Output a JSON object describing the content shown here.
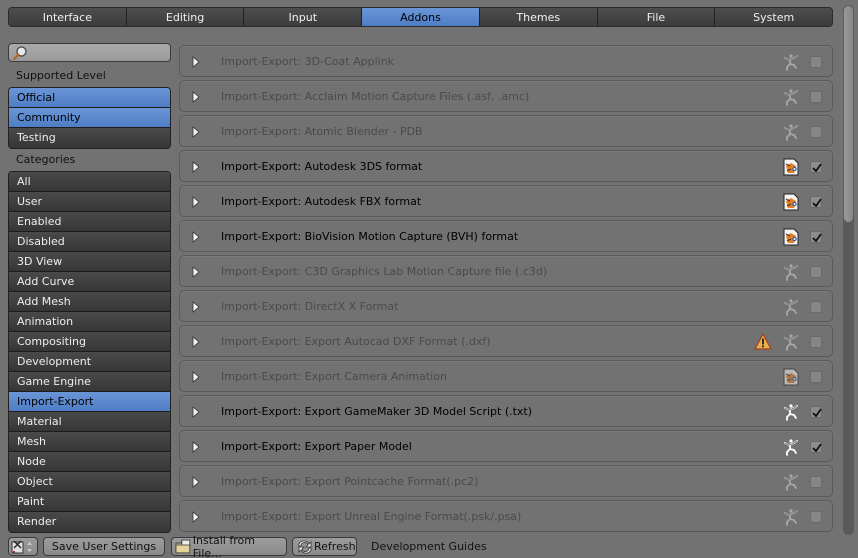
{
  "tabs": [
    {
      "label": "Interface",
      "active": false
    },
    {
      "label": "Editing",
      "active": false
    },
    {
      "label": "Input",
      "active": false
    },
    {
      "label": "Addons",
      "active": true
    },
    {
      "label": "Themes",
      "active": false
    },
    {
      "label": "File",
      "active": false
    },
    {
      "label": "System",
      "active": false
    }
  ],
  "sidebar": {
    "search_value": "",
    "supported_level_label": "Supported Level",
    "supported_levels": [
      {
        "label": "Official",
        "active": true
      },
      {
        "label": "Community",
        "active": true
      },
      {
        "label": "Testing",
        "active": false
      }
    ],
    "categories_label": "Categories",
    "categories": [
      {
        "label": "All",
        "active": false
      },
      {
        "label": "User",
        "active": false
      },
      {
        "label": "Enabled",
        "active": false
      },
      {
        "label": "Disabled",
        "active": false
      },
      {
        "label": "3D View",
        "active": false
      },
      {
        "label": "Add Curve",
        "active": false
      },
      {
        "label": "Add Mesh",
        "active": false
      },
      {
        "label": "Animation",
        "active": false
      },
      {
        "label": "Compositing",
        "active": false
      },
      {
        "label": "Development",
        "active": false
      },
      {
        "label": "Game Engine",
        "active": false
      },
      {
        "label": "Import-Export",
        "active": true
      },
      {
        "label": "Material",
        "active": false
      },
      {
        "label": "Mesh",
        "active": false
      },
      {
        "label": "Node",
        "active": false
      },
      {
        "label": "Object",
        "active": false
      },
      {
        "label": "Paint",
        "active": false
      },
      {
        "label": "Render",
        "active": false
      }
    ]
  },
  "addons": [
    {
      "name": "Import-Export: 3D-Coat Applink",
      "enabled": false,
      "icon": "community-icon",
      "warning": false
    },
    {
      "name": "Import-Export: Acclaim Motion Capture Files (.asf, .amc)",
      "enabled": false,
      "icon": "community-icon",
      "warning": false
    },
    {
      "name": "Import-Export: Atomic Blender - PDB",
      "enabled": false,
      "icon": "community-icon",
      "warning": false
    },
    {
      "name": "Import-Export: Autodesk 3DS format",
      "enabled": true,
      "icon": "official-icon",
      "warning": false
    },
    {
      "name": "Import-Export: Autodesk FBX format",
      "enabled": true,
      "icon": "official-icon",
      "warning": false
    },
    {
      "name": "Import-Export: BioVision Motion Capture (BVH) format",
      "enabled": true,
      "icon": "official-icon",
      "warning": false
    },
    {
      "name": "Import-Export: C3D Graphics Lab Motion Capture file (.c3d)",
      "enabled": false,
      "icon": "community-icon",
      "warning": false
    },
    {
      "name": "Import-Export: DirectX X Format",
      "enabled": false,
      "icon": "community-icon",
      "warning": false
    },
    {
      "name": "Import-Export: Export Autocad DXF Format (.dxf)",
      "enabled": false,
      "icon": "community-icon",
      "warning": true
    },
    {
      "name": "Import-Export: Export Camera Animation",
      "enabled": false,
      "icon": "official-icon",
      "warning": false
    },
    {
      "name": "Import-Export: Export GameMaker 3D Model Script (.txt)",
      "enabled": true,
      "icon": "community-icon",
      "warning": false
    },
    {
      "name": "Import-Export: Export Paper Model",
      "enabled": true,
      "icon": "community-icon",
      "warning": false
    },
    {
      "name": "Import-Export: Export Pointcache Format(.pc2)",
      "enabled": false,
      "icon": "community-icon",
      "warning": false
    },
    {
      "name": "Import-Export: Export Unreal Engine Format(.psk/.psa)",
      "enabled": false,
      "icon": "community-icon",
      "warning": false
    }
  ],
  "bottom": {
    "save_label": "Save User Settings",
    "install_label": "Install from File...",
    "refresh_label": "Refresh",
    "dev_guides_label": "Development Guides"
  },
  "colors": {
    "accent": "#5a87cc",
    "background": "#727272",
    "warning": "#e8b04a"
  }
}
